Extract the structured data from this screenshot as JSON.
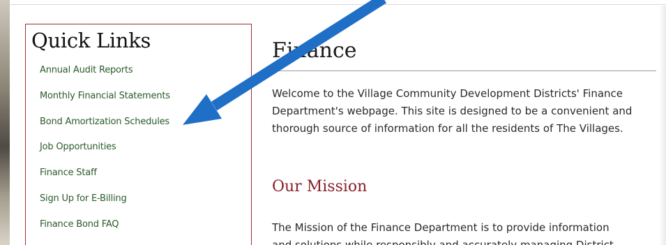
{
  "quick_links": {
    "title": "Quick Links",
    "items": [
      {
        "label": "Annual Audit Reports"
      },
      {
        "label": "Monthly Financial Statements"
      },
      {
        "label": "Bond Amortization Schedules"
      },
      {
        "label": "Job Opportunities"
      },
      {
        "label": "Finance Staff"
      },
      {
        "label": "Sign Up for E-Billing"
      },
      {
        "label": "Finance Bond FAQ"
      }
    ]
  },
  "main": {
    "title": "Finance",
    "intro": "Welcome to the Village Community Development Districts' Finance Department's webpage. This site is designed to be a convenient and thorough source of information for all the residents of The Villages.",
    "mission_heading": "Our Mission",
    "mission_text_line1": "The Mission of the Finance Department is to provide information",
    "mission_text_line2": "and solutions while responsibly and accurately managing District"
  },
  "colors": {
    "accent_border": "#9b2a36",
    "link": "#2b5a2a",
    "mission_heading": "#8a1f28",
    "annotation_arrow": "#1f6fc6"
  },
  "annotation": {
    "icon": "arrow-icon"
  }
}
